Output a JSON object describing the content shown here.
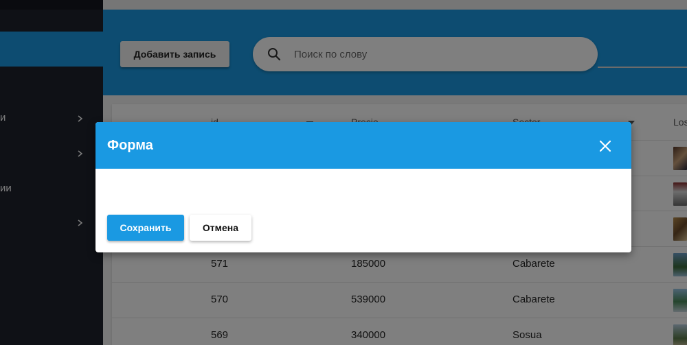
{
  "sidebar": {
    "items": [
      {
        "label": "и",
        "has_chevron": true
      },
      {
        "label": "",
        "has_chevron": true
      },
      {
        "label": "ии",
        "has_chevron": false
      },
      {
        "label": "",
        "has_chevron": true
      }
    ]
  },
  "toolbar": {
    "add_label": "Добавить запись",
    "search_placeholder": "Поиск по слову"
  },
  "table": {
    "columns": [
      "id",
      "Precio",
      "Sector",
      "Los"
    ],
    "rows": [
      {
        "id": "571",
        "precio": "185000",
        "sector": "Cabarete"
      },
      {
        "id": "570",
        "precio": "539000",
        "sector": "Cabarete"
      },
      {
        "id": "569",
        "precio": "340000",
        "sector": "Sosua"
      }
    ]
  },
  "modal": {
    "title": "Форма",
    "save_label": "Сохранить",
    "cancel_label": "Отмена"
  },
  "colors": {
    "accent": "#1a99e2",
    "sidebar": "#1e222d"
  }
}
